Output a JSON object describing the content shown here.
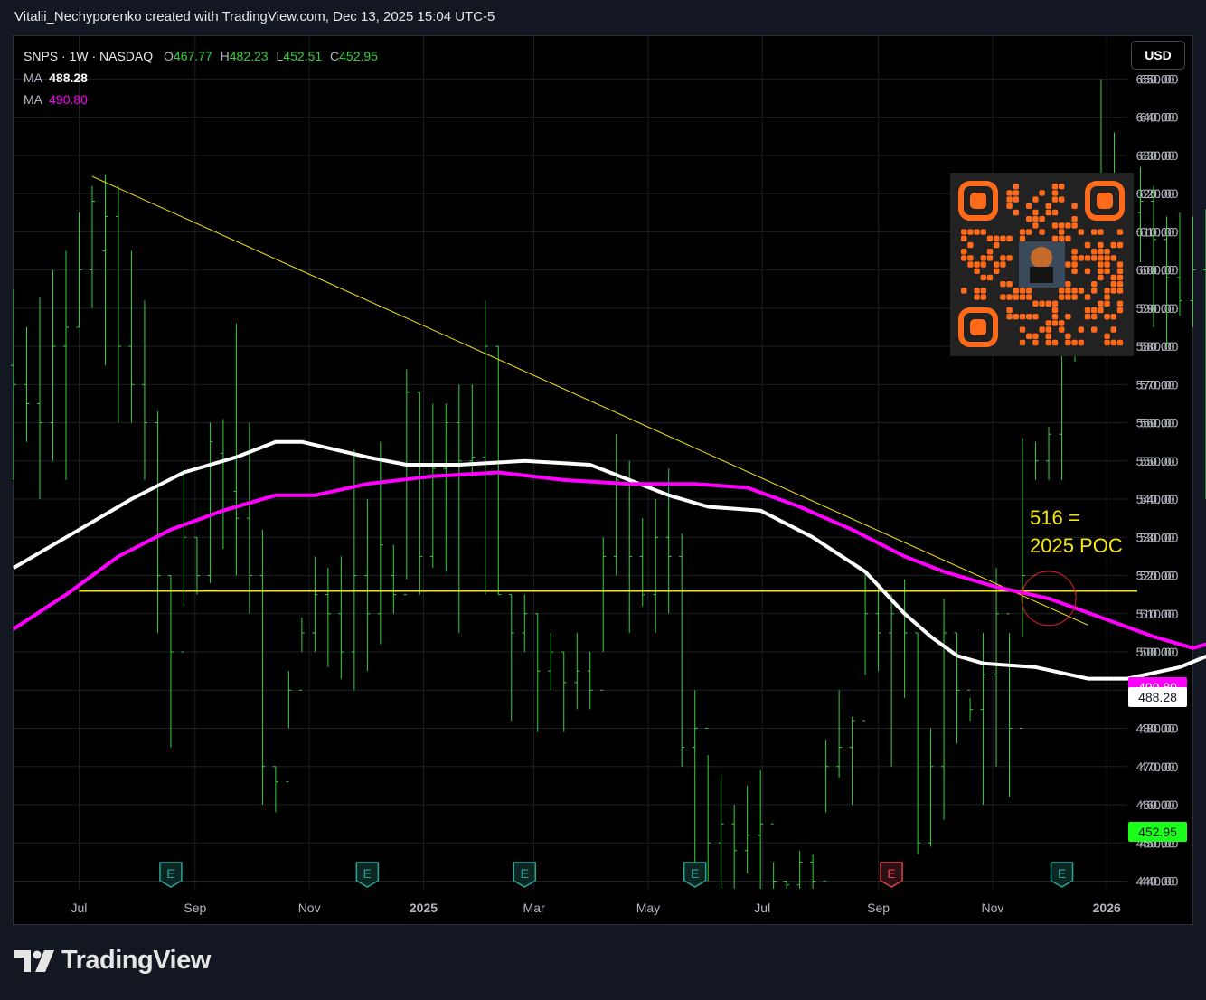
{
  "header": {
    "attribution": "Vitalii_Nechyporenko created with TradingView.com, Dec 13, 2025 15:04 UTC-5"
  },
  "legend": {
    "symbol": "SNPS · 1W · NASDAQ",
    "o_label": "O",
    "o_value": "467.77",
    "h_label": "H",
    "h_value": "482.23",
    "l_label": "L",
    "l_value": "452.51",
    "c_label": "C",
    "c_value": "452.95",
    "ma1_label": "MA",
    "ma1_value": "488.28",
    "ma2_label": "MA",
    "ma2_value": "490.80"
  },
  "currency_button": "USD",
  "annotation": {
    "line1": "516 =",
    "line2": "2025 POC"
  },
  "brand": {
    "name": "TradingView"
  },
  "colors": {
    "background": "#000000",
    "bar": "#34d13c",
    "ma_white": "#ffffff",
    "ma_magenta": "#ff00ff",
    "trendline": "#f5e60f",
    "poc_line": "#f5e60f",
    "circle": "#e31e24",
    "earnings": "#26a69a",
    "earnings_red": "#e04048",
    "qr": "#ff6a1a"
  },
  "chart_data": {
    "type": "line",
    "title": "SNPS · 1W · NASDAQ",
    "ylim": [
      437,
      655
    ],
    "y_ticks": [
      440,
      450,
      460,
      470,
      480,
      490,
      500,
      510,
      520,
      530,
      540,
      550,
      560,
      570,
      580,
      590,
      600,
      610,
      620,
      630,
      640,
      650
    ],
    "y_tick_labels": [
      "440.00",
      "450.00",
      "460.00",
      "470.00",
      "480.00",
      "490.00",
      "500.00",
      "510.00",
      "520.00",
      "530.00",
      "540.00",
      "550.00",
      "560.00",
      "570.00",
      "580.00",
      "590.00",
      "600.00",
      "610.00",
      "620.00",
      "630.00",
      "640.00",
      "650.00"
    ],
    "x_tick_labels": [
      "Jul",
      "Sep",
      "Nov",
      "2025",
      "Mar",
      "May",
      "Jul",
      "Sep",
      "Nov",
      "2026"
    ],
    "x_tick_dates": [
      "2024-07-01",
      "2024-09-01",
      "2024-11-01",
      "2025-01-01",
      "2025-03-01",
      "2025-05-01",
      "2025-07-01",
      "2025-09-01",
      "2025-11-01",
      "2026-01-01"
    ],
    "x_range": [
      "2024-05-27",
      "2026-01-12"
    ],
    "bars_weekly_ohlc": {
      "start_week": "2024-05-27",
      "ohlc": [
        [
          575,
          595,
          545,
          570
        ],
        [
          570,
          585,
          555,
          565
        ],
        [
          565,
          593,
          540,
          560
        ],
        [
          560,
          600,
          550,
          580
        ],
        [
          580,
          605,
          545,
          585
        ],
        [
          585,
          615,
          585,
          600
        ],
        [
          600,
          622,
          590,
          618
        ],
        [
          605,
          625,
          575,
          614
        ],
        [
          614,
          622,
          560,
          580
        ],
        [
          580,
          605,
          560,
          570
        ],
        [
          570,
          592,
          545,
          560
        ],
        [
          560,
          563,
          505,
          520
        ],
        [
          520,
          520,
          475,
          500
        ],
        [
          500,
          548,
          512,
          530
        ],
        [
          530,
          530,
          515,
          520
        ],
        [
          520,
          560,
          518,
          555
        ],
        [
          552,
          561,
          527,
          550
        ],
        [
          542,
          586,
          520,
          535
        ],
        [
          535,
          560,
          510,
          520
        ],
        [
          520,
          532,
          460,
          470
        ],
        [
          470,
          470,
          458,
          466
        ],
        [
          466,
          495,
          480,
          490
        ],
        [
          490,
          509,
          500,
          505
        ],
        [
          505,
          525,
          500,
          515
        ],
        [
          515,
          522,
          496,
          510
        ],
        [
          510,
          525,
          493,
          500
        ],
        [
          500,
          553,
          490,
          520
        ],
        [
          520,
          540,
          495,
          510
        ],
        [
          510,
          555,
          502,
          528
        ],
        [
          520,
          528,
          510,
          515
        ],
        [
          515,
          574,
          519,
          568
        ],
        [
          568,
          568,
          515,
          525
        ],
        [
          525,
          565,
          522,
          548
        ],
        [
          548,
          565,
          521,
          560
        ],
        [
          560,
          570,
          505,
          550
        ],
        [
          550,
          570,
          546,
          551
        ],
        [
          551,
          592,
          515,
          580
        ],
        [
          580,
          580,
          515,
          515
        ],
        [
          515,
          515,
          482,
          505
        ],
        [
          505,
          515,
          500,
          510
        ],
        [
          510,
          510,
          479,
          495
        ],
        [
          495,
          505,
          490,
          500
        ],
        [
          500,
          500,
          479,
          492
        ],
        [
          492,
          505,
          485,
          495
        ],
        [
          495,
          500,
          485,
          490
        ],
        [
          490,
          530,
          500,
          525
        ],
        [
          525,
          557,
          520,
          545
        ],
        [
          545,
          550,
          505,
          525
        ],
        [
          525,
          535,
          512,
          515
        ],
        [
          515,
          540,
          505,
          530
        ],
        [
          530,
          548,
          510,
          525
        ],
        [
          525,
          531,
          470,
          475
        ],
        [
          475,
          490,
          440,
          480
        ],
        [
          480,
          473,
          440,
          450
        ],
        [
          450,
          468,
          438,
          455
        ],
        [
          455,
          460,
          438,
          448
        ],
        [
          448,
          465,
          442,
          452
        ],
        [
          452,
          469,
          438,
          455
        ],
        [
          455,
          445,
          438,
          440
        ],
        [
          440,
          440,
          437,
          439
        ],
        [
          439,
          448,
          437,
          445
        ],
        [
          445,
          447,
          437,
          440
        ],
        [
          440,
          477,
          458,
          470
        ],
        [
          470,
          490,
          467,
          475
        ],
        [
          475,
          483,
          460,
          482
        ],
        [
          482,
          521,
          494,
          510
        ],
        [
          510,
          517,
          495,
          505
        ],
        [
          505,
          515,
          470,
          510
        ],
        [
          510,
          519,
          488,
          505
        ],
        [
          505,
          505,
          447,
          450
        ],
        [
          450,
          480,
          449,
          470
        ],
        [
          470,
          514,
          456,
          505
        ],
        [
          505,
          505,
          476,
          490
        ],
        [
          490,
          488,
          482,
          485
        ],
        [
          485,
          505,
          460,
          494
        ],
        [
          494,
          522,
          470,
          510
        ],
        [
          510,
          505,
          462,
          480
        ],
        [
          480,
          556,
          504,
          520
        ],
        [
          520,
          555,
          545,
          550
        ],
        [
          550,
          559,
          545,
          557
        ],
        [
          557,
          600,
          545,
          580
        ],
        [
          580,
          613,
          576,
          590
        ],
        [
          590,
          614,
          591,
          600
        ],
        [
          600,
          650,
          585,
          620
        ],
        [
          620,
          636,
          610,
          620
        ],
        [
          610,
          625,
          600,
          615
        ],
        [
          615,
          627,
          602,
          618
        ],
        [
          618,
          622,
          585,
          608
        ],
        [
          608,
          614,
          580,
          598
        ],
        [
          598,
          615,
          588,
          592
        ],
        [
          592,
          614,
          585,
          600
        ],
        [
          600,
          616,
          540,
          508
        ],
        [
          508,
          516,
          448,
          455
        ],
        [
          455,
          497,
          443,
          470
        ],
        [
          470,
          515,
          450,
          460
        ],
        [
          460,
          495,
          464,
          476
        ],
        [
          476,
          493,
          440,
          470
        ],
        [
          470,
          455,
          442,
          452
        ],
        [
          452,
          475,
          448,
          468
        ],
        [
          468,
          476,
          453,
          462
        ],
        [
          462,
          452,
          442,
          447
        ],
        [
          447,
          451,
          438,
          440
        ],
        [
          440,
          440,
          437,
          438
        ],
        [
          438,
          472,
          448,
          462
        ],
        [
          467.77,
          482.23,
          452.51,
          452.95
        ]
      ]
    },
    "series": [
      {
        "name": "MA",
        "value": 488.28,
        "color": "#ffffff",
        "points": [
          [
            0,
            522
          ],
          [
            4,
            530
          ],
          [
            9,
            540
          ],
          [
            13,
            547
          ],
          [
            17,
            551
          ],
          [
            20,
            555
          ],
          [
            22,
            555
          ],
          [
            27,
            551
          ],
          [
            30,
            549
          ],
          [
            34,
            549
          ],
          [
            39,
            550
          ],
          [
            44,
            549
          ],
          [
            50,
            541
          ],
          [
            53,
            538
          ],
          [
            57,
            537
          ],
          [
            61,
            530
          ],
          [
            65,
            521
          ],
          [
            68,
            510
          ],
          [
            70,
            504
          ],
          [
            72,
            499
          ],
          [
            74,
            497
          ],
          [
            78,
            496
          ],
          [
            82,
            493
          ],
          [
            85,
            493
          ],
          [
            89,
            496
          ],
          [
            94,
            503
          ],
          [
            98,
            510
          ],
          [
            101,
            513
          ],
          [
            104,
            508
          ],
          [
            108,
            505
          ],
          [
            111,
            503
          ],
          [
            116,
            500
          ],
          [
            119,
            495
          ],
          [
            121,
            490
          ],
          [
            124,
            488.28
          ]
        ]
      },
      {
        "name": "MA",
        "value": 490.8,
        "color": "#ff00ff",
        "points": [
          [
            0,
            506
          ],
          [
            4,
            515
          ],
          [
            8,
            525
          ],
          [
            12,
            532
          ],
          [
            16,
            537
          ],
          [
            20,
            541
          ],
          [
            23,
            541
          ],
          [
            27,
            544
          ],
          [
            32,
            546
          ],
          [
            37,
            547
          ],
          [
            42,
            545
          ],
          [
            47,
            544
          ],
          [
            52,
            544
          ],
          [
            56,
            543
          ],
          [
            60,
            538
          ],
          [
            64,
            532
          ],
          [
            68,
            525
          ],
          [
            71,
            521
          ],
          [
            75,
            517
          ],
          [
            79,
            514
          ],
          [
            83,
            509
          ],
          [
            87,
            504
          ],
          [
            90,
            501
          ],
          [
            94,
            505
          ],
          [
            98,
            510
          ],
          [
            101,
            512
          ],
          [
            104,
            511
          ],
          [
            108,
            508
          ],
          [
            111,
            506
          ],
          [
            115,
            504
          ],
          [
            118,
            500
          ],
          [
            121,
            494
          ],
          [
            124,
            490.8
          ]
        ]
      }
    ],
    "horizontal_lines": [
      {
        "label": "516 = 2025 POC",
        "y": 516
      }
    ],
    "trendline": {
      "from": [
        "2024-07-08",
        624.5
      ],
      "to": [
        "2025-12-22",
        507
      ]
    },
    "circle_center": [
      "2025-12-01",
      514
    ],
    "earnings_markers": [
      {
        "date": "2024-08-19",
        "label": "E"
      },
      {
        "date": "2024-12-02",
        "label": "E"
      },
      {
        "date": "2025-02-24",
        "label": "E"
      },
      {
        "date": "2025-05-26",
        "label": "E"
      },
      {
        "date": "2025-09-08",
        "label": "E",
        "negative": true
      },
      {
        "date": "2025-12-08",
        "label": "E"
      }
    ],
    "last_price": {
      "label": "452.95",
      "value": 452.95
    },
    "ma_tags": [
      {
        "label": "490.80",
        "value": 490.8
      },
      {
        "label": "488.28",
        "value": 488.28
      }
    ],
    "grid": true,
    "legend": "top-left"
  }
}
